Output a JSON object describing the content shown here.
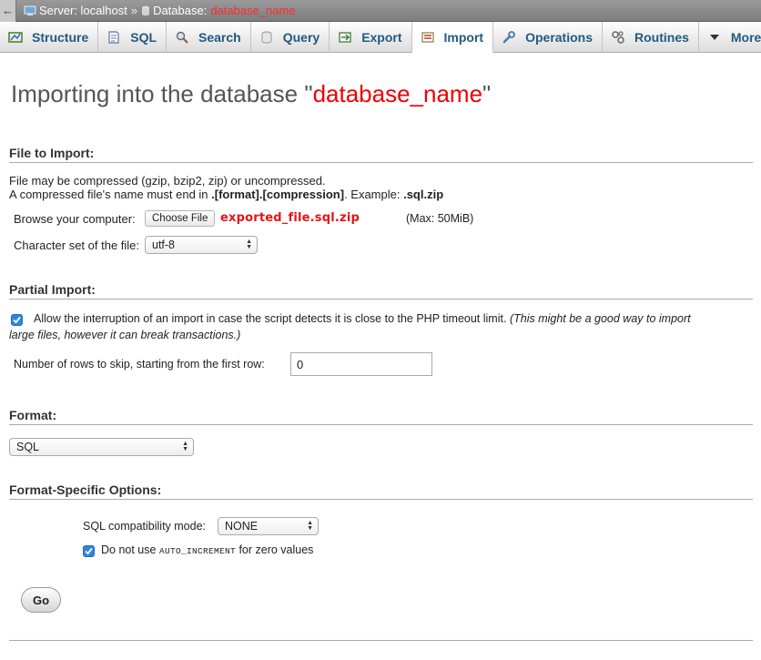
{
  "breadcrumb": {
    "server_label": "Server: localhost",
    "separator": "»",
    "database_label": "Database:",
    "database_name": "database_name"
  },
  "tabs": [
    {
      "label": "Structure",
      "icon": "structure-icon"
    },
    {
      "label": "SQL",
      "icon": "sql-icon"
    },
    {
      "label": "Search",
      "icon": "search-icon"
    },
    {
      "label": "Query",
      "icon": "query-icon"
    },
    {
      "label": "Export",
      "icon": "export-icon"
    },
    {
      "label": "Import",
      "icon": "import-icon",
      "active": true
    },
    {
      "label": "Operations",
      "icon": "wrench-icon"
    },
    {
      "label": "Routines",
      "icon": "routines-icon"
    },
    {
      "label": "More",
      "icon": "chevron-down-icon"
    }
  ],
  "page": {
    "title_prefix": "Importing into the database \"",
    "title_db": "database_name",
    "title_suffix": "\""
  },
  "file_import": {
    "heading": "File to Import:",
    "line1": "File may be compressed (gzip, bzip2, zip) or uncompressed.",
    "line2_prefix": "A compressed file's name must end in ",
    "line2_bold": ".[format].[compression]",
    "line2_mid": ". Example: ",
    "line2_example": ".sql.zip",
    "browse_label": "Browse your computer:",
    "choose_button": "Choose File",
    "file_name": "exported_file.sql.zip",
    "max_size": "(Max: 50MiB)",
    "charset_label": "Character set of the file:",
    "charset_value": "utf-8"
  },
  "partial_import": {
    "heading": "Partial Import:",
    "allow_interrupt_checked": true,
    "allow_interrupt_text": "Allow the interruption of an import in case the script detects it is close to the PHP timeout limit.",
    "allow_interrupt_note_1": "(This might be a good way to import",
    "allow_interrupt_note_2": "large files, however it can break transactions.)",
    "skip_label": "Number of rows to skip, starting from the first row:",
    "skip_value": "0"
  },
  "format": {
    "heading": "Format:",
    "value": "SQL"
  },
  "format_options": {
    "heading": "Format-Specific Options:",
    "compat_label": "SQL compatibility mode:",
    "compat_value": "NONE",
    "no_auto_inc_checked": true,
    "no_auto_inc_prefix": "Do not use",
    "no_auto_inc_code": "AUTO_INCREMENT",
    "no_auto_inc_suffix": "for zero values"
  },
  "go_button": "Go",
  "colors": {
    "accent_red": "#ee0000",
    "tab_text": "#235a81",
    "checkbox_blue": "#2f86e0"
  }
}
